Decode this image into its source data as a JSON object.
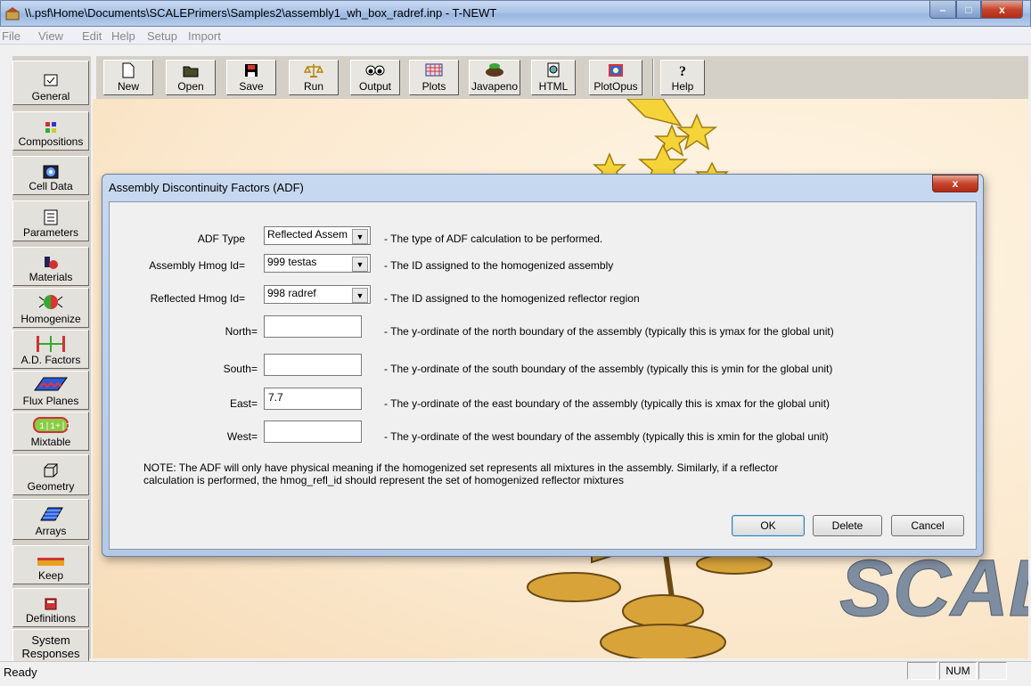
{
  "window": {
    "title": "\\\\.psf\\Home\\Documents\\SCALEPrimers\\Samples2\\assembly1_wh_box_radref.inp - T-NEWT",
    "minimize": "–",
    "maximize": "□",
    "close": "x"
  },
  "menu": [
    "File",
    "View",
    "Edit",
    "Help",
    "Setup",
    "Import"
  ],
  "toolbar": [
    "New",
    "Open",
    "Save",
    "Run",
    "Output",
    "Plots",
    "Javapeno",
    "HTML",
    "PlotOpus",
    "Help"
  ],
  "sidebar": [
    "General",
    "Compositions",
    "Cell Data",
    "Parameters",
    "Materials",
    "Homogenize",
    "A.D. Factors",
    "Flux Planes",
    "Mixtable",
    "Geometry",
    "Arrays",
    "Keep",
    "Definitions",
    "System Responses"
  ],
  "status": {
    "text": "Ready",
    "num": "NUM"
  },
  "dialog": {
    "title": "Assembly Discontinuity Factors (ADF)",
    "close": "x",
    "fields": [
      {
        "label": "ADF Type",
        "value": "Reflected Assem",
        "desc": "- The type of ADF calculation to be performed."
      },
      {
        "label": "Assembly Hmog Id=",
        "value": "999 testas",
        "desc": "- The ID assigned to the homogenized assembly"
      },
      {
        "label": "Reflected Hmog Id=",
        "value": "998 radref",
        "desc": "- The ID assigned to the homogenized reflector region"
      },
      {
        "label": "North=",
        "value": "",
        "desc": "- The y-ordinate of the north boundary of the assembly (typically this is ymax for the global unit)"
      },
      {
        "label": "South=",
        "value": "",
        "desc": "- The y-ordinate of the south boundary of the assembly (typically this is ymin for the global unit)"
      },
      {
        "label": "East=",
        "value": "7.7",
        "desc": "- The y-ordinate of the east boundary of the assembly (typically this is xmax for the global unit)"
      },
      {
        "label": "West=",
        "value": "",
        "desc": "- The y-ordinate of the west boundary of the assembly (typically this is xmin for the global unit)"
      }
    ],
    "note_line1": "NOTE: The ADF will only have physical meaning if the homogenized set represents all mixtures in the assembly. Similarly, if a reflector",
    "note_line2": "calculation is performed, the hmog_refl_id should represent the set of homogenized reflector mixtures",
    "buttons": {
      "ok": "OK",
      "delete": "Delete",
      "cancel": "Cancel"
    }
  },
  "background": {
    "logo_text": "SCALE"
  },
  "colors": {
    "accent": "#e8c24a",
    "dialog_frame": "#b3c9e6",
    "canvas": "#fbe9cf"
  }
}
